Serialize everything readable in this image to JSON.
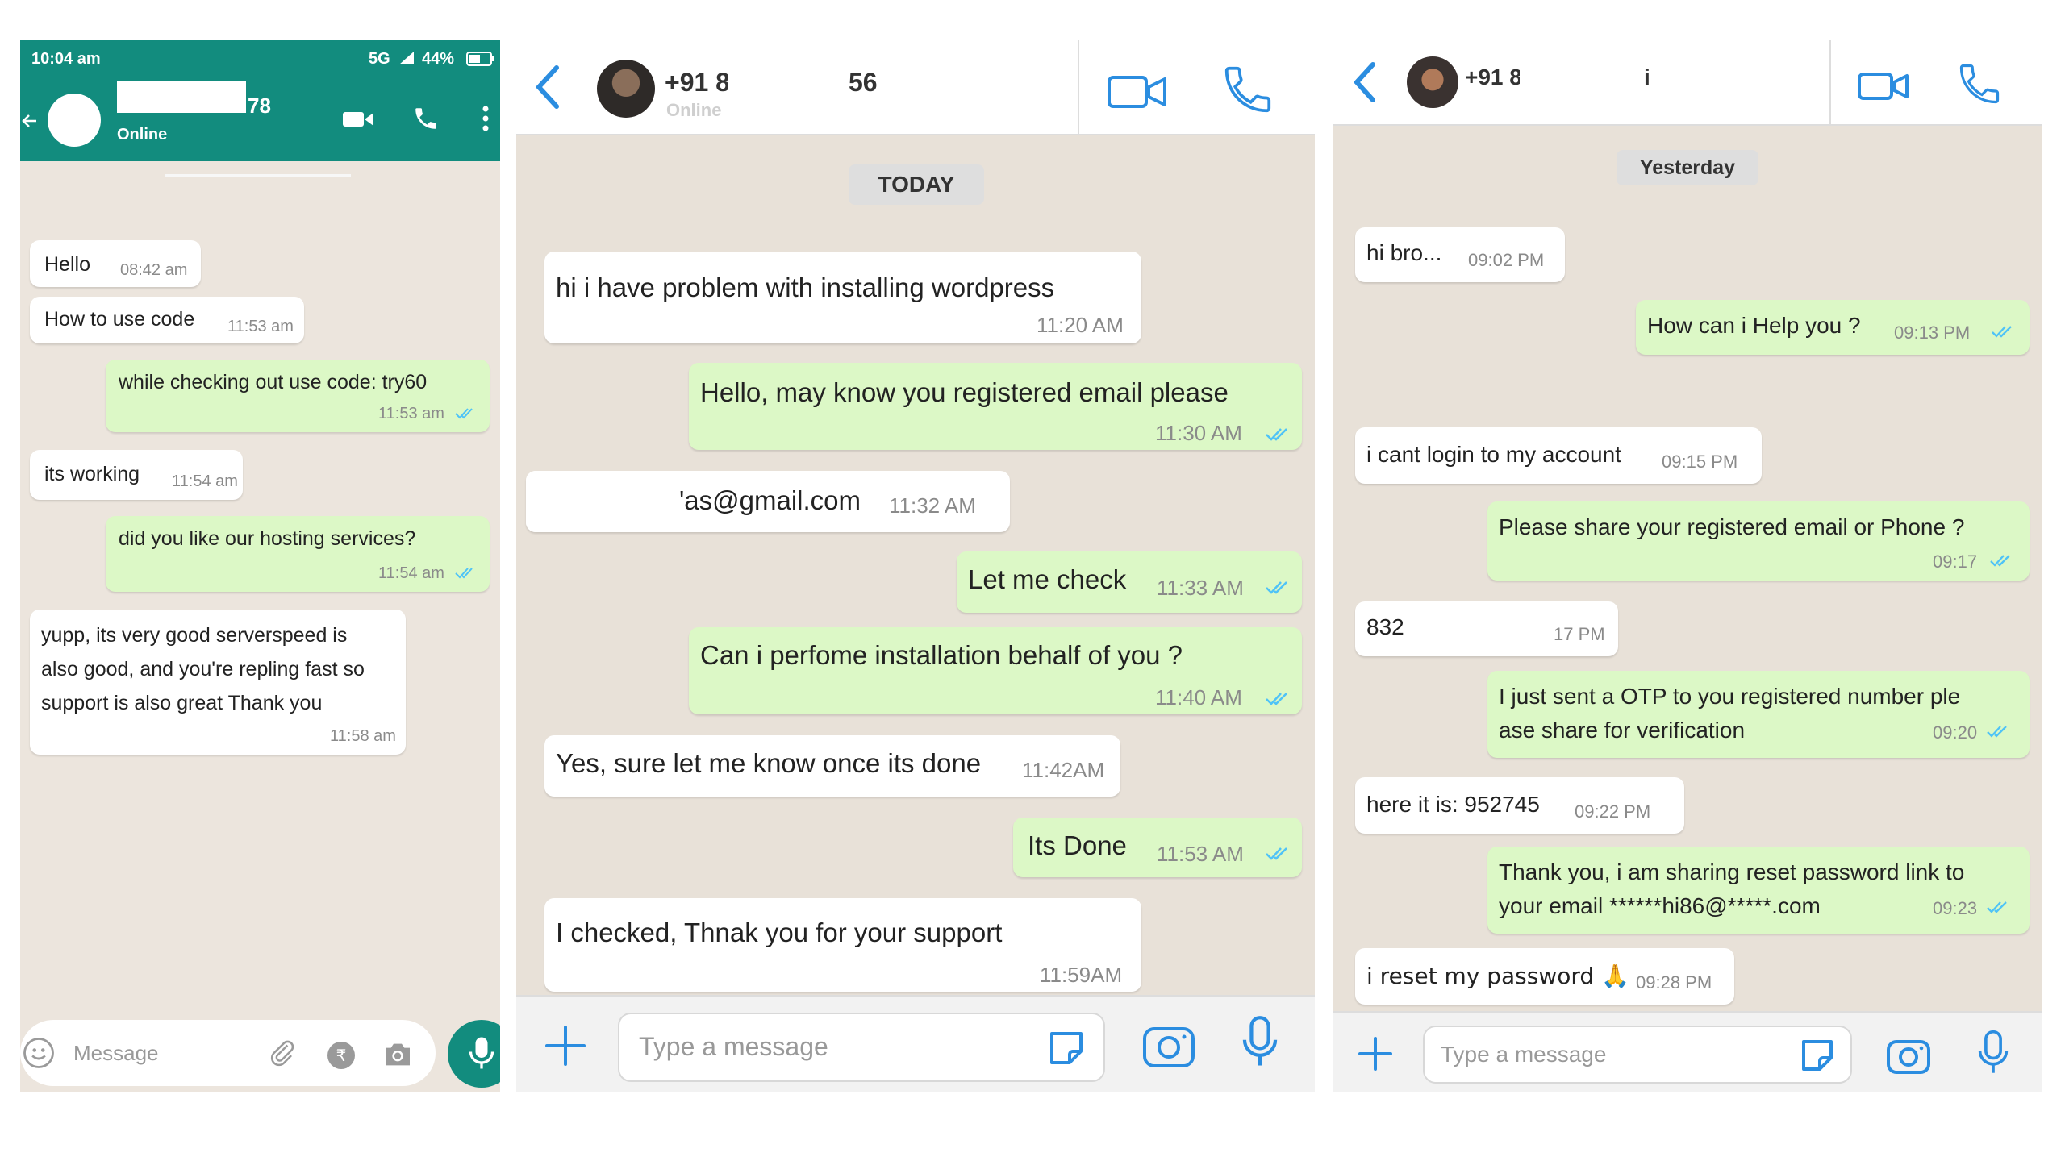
{
  "panel1": {
    "status_time": "10:04 am",
    "status_right": "5G",
    "battery": "44%",
    "contact_suffix": "78",
    "contact_status": "Online",
    "input_placeholder": "Message",
    "messages": [
      {
        "dir": "in",
        "text": "Hello",
        "time": "08:42 am"
      },
      {
        "dir": "in",
        "text": "How to use code",
        "time": "11:53 am"
      },
      {
        "dir": "out",
        "text": "while checking out use code: try60",
        "time": "11:53 am"
      },
      {
        "dir": "in",
        "text": "its working",
        "time": "11:54 am"
      },
      {
        "dir": "out",
        "text": "did you like our hosting services?",
        "time": "11:54 am"
      },
      {
        "dir": "in",
        "lines": [
          "yupp, its very good serverspeed is",
          "also good, and you're repling fast so",
          "support is also great Thank you"
        ],
        "time": "11:58 am"
      }
    ]
  },
  "panel2": {
    "contact_prefix": "+91 8",
    "contact_suffix": "56",
    "contact_status": "Online",
    "date_chip": "TODAY",
    "input_placeholder": "Type a message",
    "messages": [
      {
        "dir": "in",
        "text": "hi i have problem with installing wordpress",
        "time": "11:20 AM"
      },
      {
        "dir": "out",
        "text": "Hello, may know you registered email please",
        "time": "11:30 AM"
      },
      {
        "dir": "in",
        "text": "'as@gmail.com",
        "time": "11:32 AM"
      },
      {
        "dir": "out",
        "text": "Let me check",
        "time": "11:33 AM"
      },
      {
        "dir": "out",
        "text": "Can i perfome installation behalf of you ?",
        "time": "11:40 AM"
      },
      {
        "dir": "in",
        "text": "Yes, sure let me know once its done",
        "time": "11:42AM"
      },
      {
        "dir": "out",
        "text": "Its Done",
        "time": "11:53 AM"
      },
      {
        "dir": "in",
        "text": "I checked, Thnak you for your support",
        "time": "11:59AM"
      }
    ]
  },
  "panel3": {
    "contact_prefix": "+91 8",
    "contact_suffix": "i",
    "date_chip": "Yesterday",
    "input_placeholder": "Type a message",
    "messages": [
      {
        "dir": "in",
        "text": "hi bro...",
        "time": "09:02 PM"
      },
      {
        "dir": "out",
        "text": "How can i Help you ?",
        "time": "09:13 PM"
      },
      {
        "dir": "in",
        "text": "i cant login to my account",
        "time": "09:15 PM"
      },
      {
        "dir": "out",
        "text": "Please share your registered email or Phone ?",
        "time": "09:17"
      },
      {
        "dir": "in",
        "text": "832",
        "time": "17 PM"
      },
      {
        "dir": "out",
        "lines": [
          "I just sent a OTP to you registered number ple",
          "ase share for verification"
        ],
        "time": "09:20"
      },
      {
        "dir": "in",
        "text": "here it is: 952745",
        "time": "09:22 PM"
      },
      {
        "dir": "out",
        "lines": [
          "Thank you, i am sharing reset password link to",
          "your email ******hi86@*****.com"
        ],
        "time": "09:23"
      },
      {
        "dir": "in",
        "text": "i reset my password 🙏",
        "time": "09:28 PM"
      }
    ]
  },
  "colors": {
    "wa_green": "#128c7e",
    "out_bubble": "#dcf8c6",
    "in_bubble": "#ffffff",
    "tick_blue": "#4fc3f7",
    "icon_blue": "#2b8de0"
  }
}
